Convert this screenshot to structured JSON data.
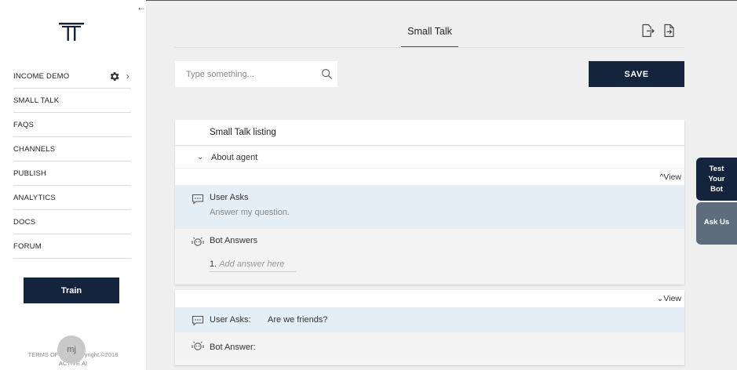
{
  "sidebar": {
    "collapse_glyph": "←",
    "logo_icon": "tt-logo-icon",
    "items": [
      {
        "label": "INCOME DEMO",
        "icon": "gear-icon"
      },
      {
        "label": "SMALL TALK"
      },
      {
        "label": "FAQS"
      },
      {
        "label": "CHANNELS"
      },
      {
        "label": "PUBLISH"
      },
      {
        "label": "ANALYTICS"
      },
      {
        "label": "DOCS"
      },
      {
        "label": "FORUM"
      }
    ],
    "train_label": "Train",
    "footer_line1": "TERMS OF USE Copyright ©2018",
    "footer_line2": "ACTIVE.AI",
    "avatar_initials": "mj"
  },
  "header": {
    "title": "Small Talk",
    "export_icon": "file-export-icon",
    "import_icon": "file-import-icon"
  },
  "search": {
    "placeholder": "Type something...",
    "value": ""
  },
  "toolbar": {
    "save_label": "SAVE"
  },
  "listing": {
    "title": "Small Talk listing",
    "group_label": "About agent",
    "view_label": "View",
    "entry1": {
      "user_asks_label": "User Asks",
      "user_asks_text": "Answer my question.",
      "bot_answers_label": "Bot Answers",
      "answer_number": "1.",
      "answer_placeholder": "Add answer here"
    },
    "entry2": {
      "view_label": "View",
      "user_asks_label": "User Asks:",
      "user_asks_text": "Are we friends?",
      "bot_answer_label": "Bot Answer:"
    }
  },
  "floating": {
    "test_bot_label": "Test Your Bot",
    "ask_us_label": "Ask Us"
  },
  "colors": {
    "primary": "#14243d",
    "user_block": "#e3eef7",
    "ask_us": "#5e6d7e"
  }
}
